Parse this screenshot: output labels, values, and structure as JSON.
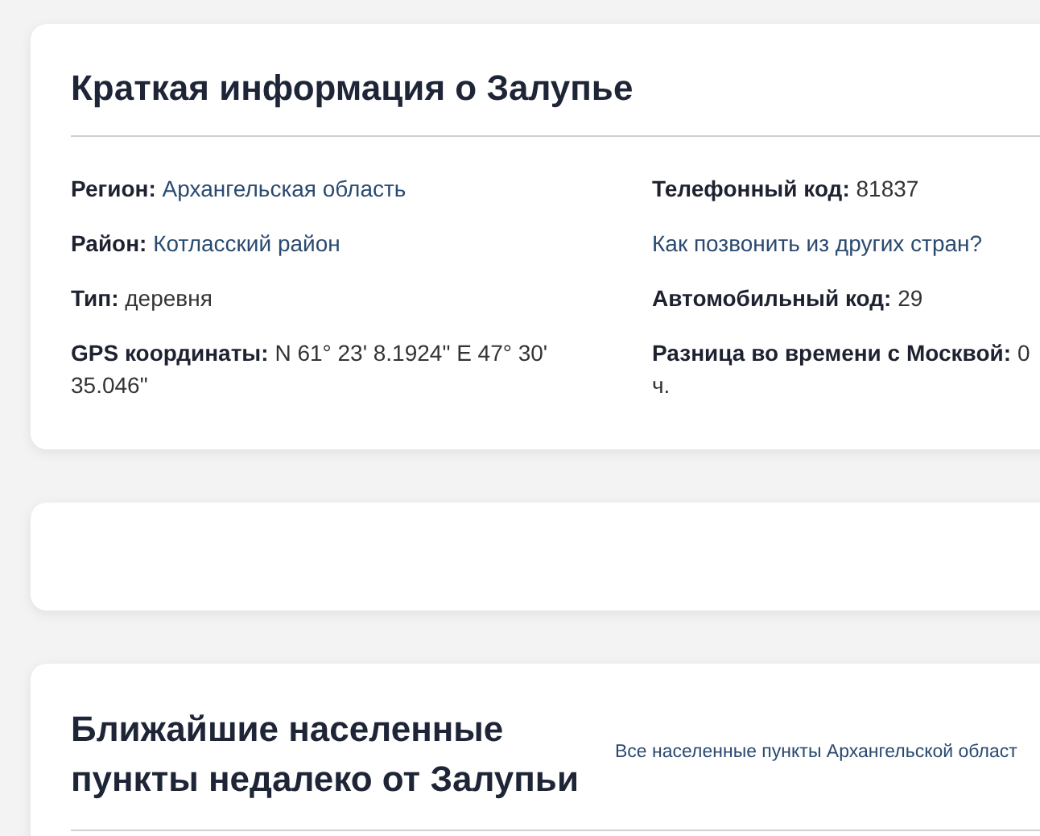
{
  "info_card": {
    "title": "Краткая информация о Залупье",
    "left": [
      {
        "kind": "pair",
        "label": "Регион:",
        "value": "Архангельская область",
        "link": true
      },
      {
        "kind": "pair",
        "label": "Район:",
        "value": "Котласский район",
        "link": true
      },
      {
        "kind": "pair",
        "label": "Тип:",
        "value": "деревня",
        "link": false
      },
      {
        "kind": "pair",
        "label": "GPS координаты:",
        "value": "N 61° 23' 8.1924\" E 47° 30' 35.046\"",
        "link": false
      }
    ],
    "right": [
      {
        "kind": "pair",
        "label": "Телефонный код:",
        "value": "81837",
        "link": false
      },
      {
        "kind": "link",
        "value": "Как позвонить из других стран?"
      },
      {
        "kind": "pair",
        "label": "Автомобильный код:",
        "value": "29",
        "link": false
      },
      {
        "kind": "pair",
        "label": "Разница во времени с Москвой:",
        "value": "0 ч.",
        "link": false
      }
    ]
  },
  "nearby_card": {
    "title": "Ближайшие населенные пункты недалеко от Залупьи",
    "link": "Все населенные пункты Архангельской област"
  }
}
